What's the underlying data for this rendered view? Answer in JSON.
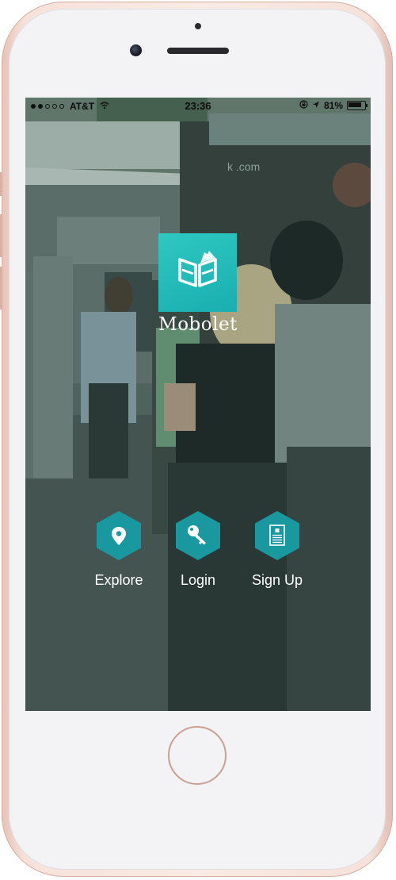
{
  "status_bar": {
    "carrier": "AT&T",
    "time": "23:36",
    "battery": "81%"
  },
  "app": {
    "name": "Mobolet"
  },
  "actions": [
    {
      "label": "Explore",
      "icon": "map-pin-icon"
    },
    {
      "label": "Login",
      "icon": "key-icon"
    },
    {
      "label": "Sign Up",
      "icon": "id-card-icon"
    }
  ],
  "colors": {
    "accent": "#1fb3b0",
    "hex_button": "#1a98a0",
    "phone_frame": "#f2d6cd"
  }
}
